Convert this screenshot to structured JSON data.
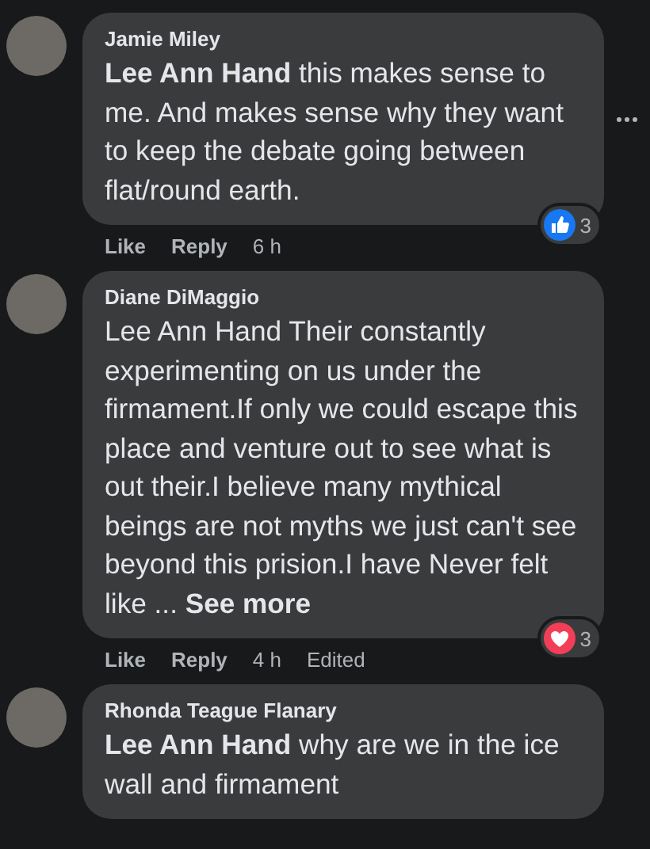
{
  "comments": [
    {
      "author": "Jamie Miley",
      "text": "**Lee Ann Hand** this makes sense to me. And makes sense why they want to keep the debate going between flat/round earth.",
      "actions": [
        "Like",
        "Reply"
      ],
      "time": "6 h",
      "reaction": {
        "kind": "like",
        "count": "3"
      },
      "menu_visible": true
    },
    {
      "author": "Diane DiMaggio",
      "text": "Lee Ann Hand Their constantly experimenting on us under the firmament.If only we could escape this place and venture out to see what is out their.I believe many mythical beings are not myths we just can't see beyond this prision.I have Never felt like ...",
      "see_more": "See more",
      "actions": [
        "Like",
        "Reply"
      ],
      "time": "4 h",
      "edited": "Edited",
      "reaction": {
        "kind": "love",
        "count": "3"
      },
      "menu_visible": false
    },
    {
      "author": "Rhonda Teague Flanary",
      "text": "**Lee Ann Hand** why are we in the ice wall and firmament",
      "menu_visible": false
    }
  ]
}
